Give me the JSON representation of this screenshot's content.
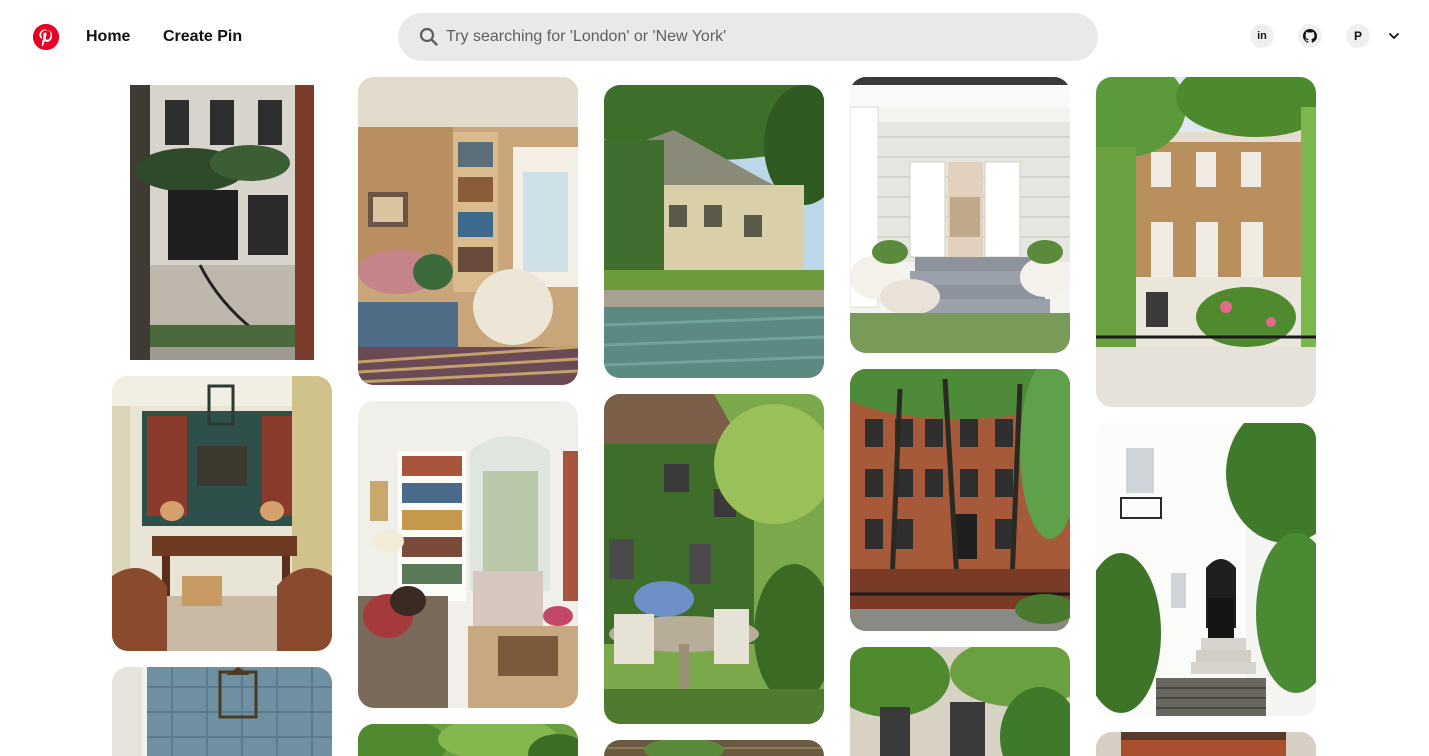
{
  "header": {
    "logo_icon": "pinterest-logo-icon",
    "brand_color": "#e60023",
    "nav": {
      "home_label": "Home",
      "create_label": "Create Pin"
    },
    "search": {
      "placeholder": "Try searching for 'London' or 'New York'",
      "value": ""
    },
    "actions": {
      "linkedin_label": "in",
      "profile_initial": "P"
    }
  },
  "pins": [
    {
      "subject": "brownstone townhouse facade with ivy",
      "col": 1
    },
    {
      "subject": "green library room with lantern",
      "col": 1
    },
    {
      "subject": "blue tiled room with lantern",
      "col": 1
    },
    {
      "subject": "wood-paneled reading nook",
      "col": 2
    },
    {
      "subject": "white living room with bookshelves",
      "col": 2
    },
    {
      "subject": "garden treetops",
      "col": 2
    },
    {
      "subject": "ivy-covered house with pool",
      "col": 3
    },
    {
      "subject": "ivy cottage with patio dining",
      "col": 3
    },
    {
      "subject": "stone wall",
      "col": 3
    },
    {
      "subject": "white porch with flower pots",
      "col": 4
    },
    {
      "subject": "red brick brownstones with trees",
      "col": 4
    },
    {
      "subject": "townhouse behind green trees",
      "col": 4
    },
    {
      "subject": "brick London townhouse",
      "col": 5
    },
    {
      "subject": "white stucco house with black door",
      "col": 5
    },
    {
      "subject": "red brick building",
      "col": 5
    }
  ]
}
